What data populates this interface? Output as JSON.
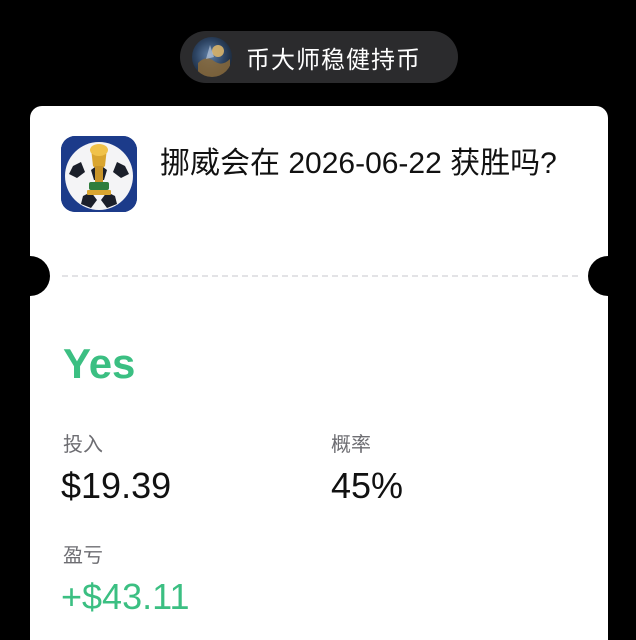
{
  "user": {
    "name": "币大师稳健持币",
    "avatar_icon": "user-avatar-globe-icon"
  },
  "market": {
    "icon": "world-cup-trophy-soccer-ball-icon",
    "title": "挪威会在 2026-06-22 获胜吗?"
  },
  "position": {
    "outcome": "Yes",
    "stake_label": "投入",
    "stake_value": "$19.39",
    "probability_label": "概率",
    "probability_value": "45%",
    "pnl_label": "盈亏",
    "pnl_value": "+$43.11"
  },
  "colors": {
    "background": "#000000",
    "card": "#ffffff",
    "pill": "#2b2b2d",
    "accent_green": "#3bbf82",
    "icon_blue": "#1c3b8a"
  }
}
